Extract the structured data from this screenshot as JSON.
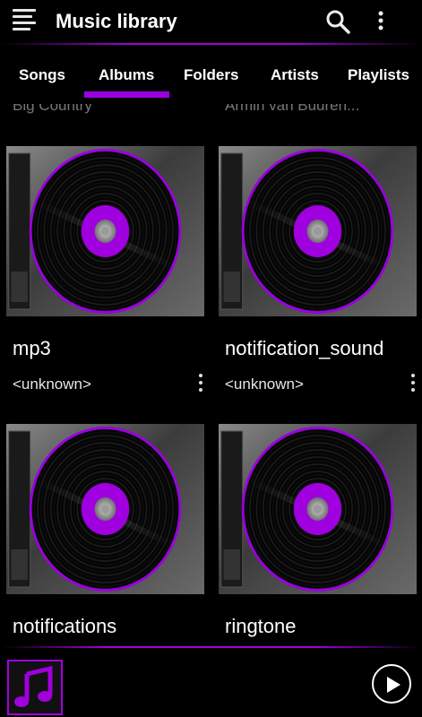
{
  "header": {
    "title": "Music library",
    "menu_icon": "menu-icon",
    "search_icon": "search-icon",
    "more_icon": "more-vert-icon"
  },
  "tabs": [
    {
      "label": "Songs",
      "selected": false
    },
    {
      "label": "Albums",
      "selected": true
    },
    {
      "label": "Folders",
      "selected": false
    },
    {
      "label": "Artists",
      "selected": false
    },
    {
      "label": "Playlists",
      "selected": false
    }
  ],
  "previous_row": [
    "Big Country",
    "Armin van Buuren..."
  ],
  "albums": [
    {
      "title": "mp3",
      "artist": "<unknown>"
    },
    {
      "title": "notification_sound",
      "artist": "<unknown>"
    },
    {
      "title": "notifications",
      "artist": ""
    },
    {
      "title": "ringtone",
      "artist": ""
    }
  ],
  "player": {
    "art_icon": "music-note-icon",
    "play_icon": "play-icon"
  },
  "colors": {
    "accent": "#a000dc",
    "background": "#000000",
    "label_disc": "#a000e0"
  }
}
